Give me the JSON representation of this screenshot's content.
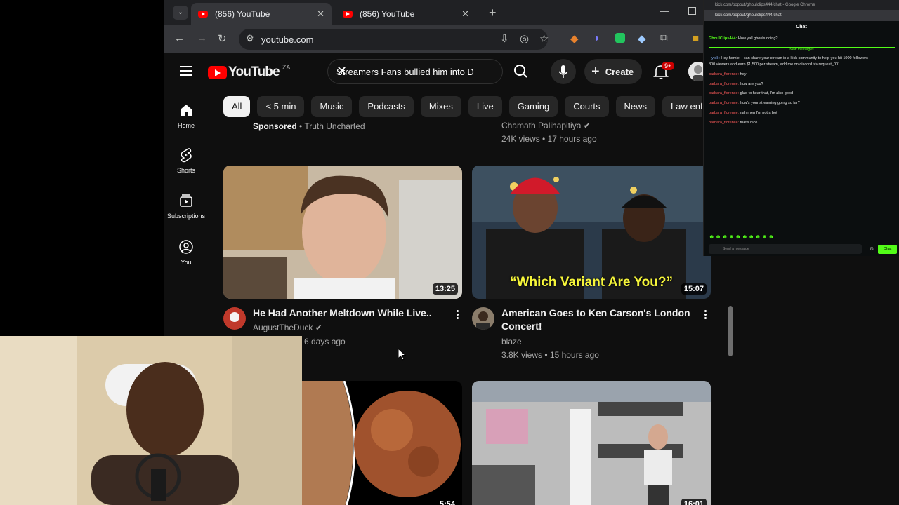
{
  "browser": {
    "tabs": [
      {
        "label": "(856) YouTube",
        "active": true
      },
      {
        "label": "(856) YouTube",
        "active": false
      }
    ],
    "address": "youtube.com"
  },
  "youtube": {
    "logo_text": "YouTube",
    "country_code": "ZA",
    "search_value": "Streamers Fans bullied him into D",
    "create_label": "Create",
    "notif_badge": "9+",
    "guide": [
      {
        "label": "Home",
        "icon": "home-icon"
      },
      {
        "label": "Shorts",
        "icon": "shorts-icon"
      },
      {
        "label": "Subscriptions",
        "icon": "subscriptions-icon"
      },
      {
        "label": "You",
        "icon": "you-icon"
      }
    ],
    "chips": [
      "All",
      "< 5 min",
      "Music",
      "Podcasts",
      "Mixes",
      "Live",
      "Gaming",
      "Courts",
      "News",
      "Law enforcer"
    ],
    "top_row": {
      "left_sponsored": "Sponsored",
      "left_channel": "Truth Uncharted",
      "right_channel": "Chamath Palihapitiya",
      "right_stats": "24K views • 17 hours ago"
    },
    "videos": [
      {
        "title": "He Had Another Meltdown While Live..",
        "channel": "AugustTheDuck",
        "stats": "6 days ago",
        "duration": "13:25"
      },
      {
        "title_line1": "American Goes to Ken Carson's London",
        "title_line2": "Concert!",
        "channel": "blaze",
        "stats": "3.8K views • 15 hours ago",
        "duration": "15:07",
        "overlay_text": "“Which Variant Are You?”"
      },
      {
        "duration": "5:54"
      },
      {
        "duration": "16:01"
      }
    ]
  },
  "kick_chat": {
    "window_title": "kick.com/popout/ghoulclips444/chat - Google Chrome",
    "url": "kick.com/popout/ghoulclips444/chat",
    "header": "Chat",
    "new_messages": "New messages",
    "messages": [
      {
        "user": "GhoulClips444:",
        "text": "How yall ghouls doing?"
      },
      {
        "user": "Hyte8:",
        "text": "Hey homie, I can share your stream in a kick community to help you hit 1000 followers"
      },
      {
        "user": "",
        "text": "800 viewers and earn $1,500 per stream, add me on discord >> request_001"
      },
      {
        "user": "barbara_florence:",
        "text": "hey"
      },
      {
        "user": "barbara_florence:",
        "text": "how are you?"
      },
      {
        "user": "barbara_florence:",
        "text": "glad to hear that, I'm also good"
      },
      {
        "user": "barbara_florence:",
        "text": "how's your streaming going so far?"
      },
      {
        "user": "barbara_florence:",
        "text": "nah men I'm not a bot"
      },
      {
        "user": "barbara_florence:",
        "text": "that's nice"
      }
    ],
    "input_placeholder": "Send a message",
    "send_label": "Chat"
  }
}
